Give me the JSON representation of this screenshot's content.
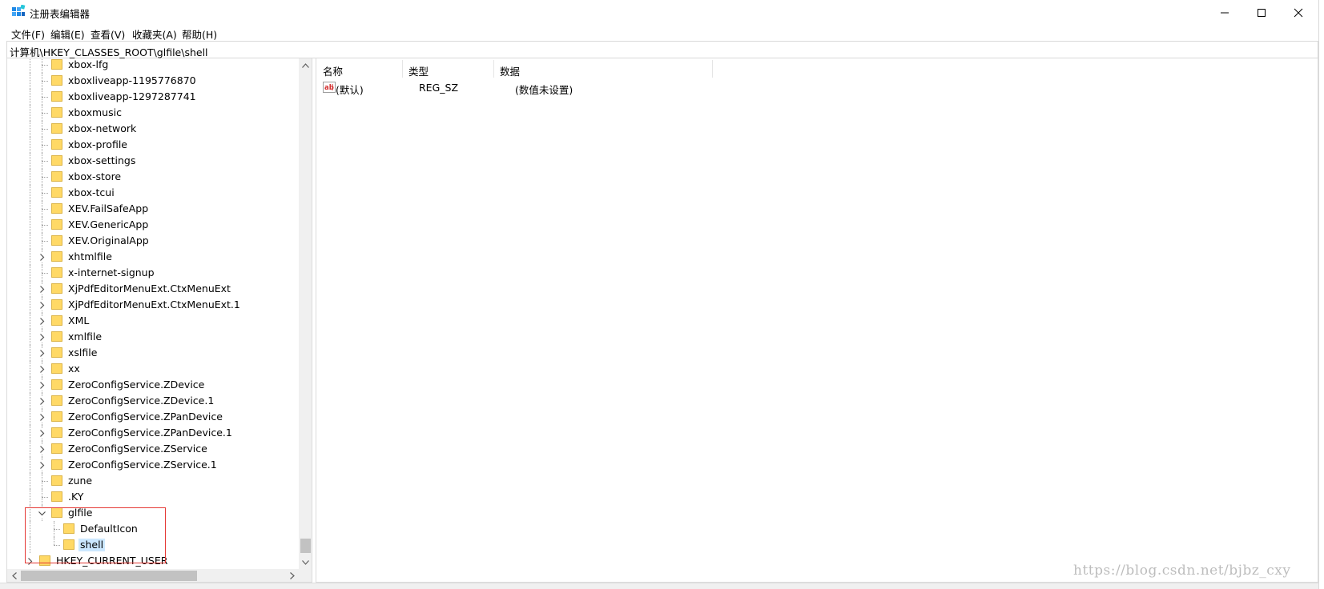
{
  "window": {
    "title": "注册表编辑器"
  },
  "menu": [
    {
      "label": "文件(F)",
      "name": "menu-file"
    },
    {
      "label": "编辑(E)",
      "name": "menu-edit"
    },
    {
      "label": "查看(V)",
      "name": "menu-view"
    },
    {
      "label": "收藏夹(A)",
      "name": "menu-favorites"
    },
    {
      "label": "帮助(H)",
      "name": "menu-help"
    }
  ],
  "address": "计算机\\HKEY_CLASSES_ROOT\\glfile\\shell",
  "tree": [
    {
      "label": "xbox-lfg",
      "level": 1,
      "expander": "none",
      "expanded": false,
      "selected": false
    },
    {
      "label": "xboxliveapp-1195776870",
      "level": 1,
      "expander": "none",
      "expanded": false,
      "selected": false
    },
    {
      "label": "xboxliveapp-1297287741",
      "level": 1,
      "expander": "none",
      "expanded": false,
      "selected": false
    },
    {
      "label": "xboxmusic",
      "level": 1,
      "expander": "none",
      "expanded": false,
      "selected": false
    },
    {
      "label": "xbox-network",
      "level": 1,
      "expander": "none",
      "expanded": false,
      "selected": false
    },
    {
      "label": "xbox-profile",
      "level": 1,
      "expander": "none",
      "expanded": false,
      "selected": false
    },
    {
      "label": "xbox-settings",
      "level": 1,
      "expander": "none",
      "expanded": false,
      "selected": false
    },
    {
      "label": "xbox-store",
      "level": 1,
      "expander": "none",
      "expanded": false,
      "selected": false
    },
    {
      "label": "xbox-tcui",
      "level": 1,
      "expander": "none",
      "expanded": false,
      "selected": false
    },
    {
      "label": "XEV.FailSafeApp",
      "level": 1,
      "expander": "none",
      "expanded": false,
      "selected": false
    },
    {
      "label": "XEV.GenericApp",
      "level": 1,
      "expander": "none",
      "expanded": false,
      "selected": false
    },
    {
      "label": "XEV.OriginalApp",
      "level": 1,
      "expander": "none",
      "expanded": false,
      "selected": false
    },
    {
      "label": "xhtmlfile",
      "level": 1,
      "expander": "collapsed",
      "expanded": false,
      "selected": false
    },
    {
      "label": "x-internet-signup",
      "level": 1,
      "expander": "none",
      "expanded": false,
      "selected": false
    },
    {
      "label": "XjPdfEditorMenuExt.CtxMenuExt",
      "level": 1,
      "expander": "collapsed",
      "expanded": false,
      "selected": false
    },
    {
      "label": "XjPdfEditorMenuExt.CtxMenuExt.1",
      "level": 1,
      "expander": "collapsed",
      "expanded": false,
      "selected": false
    },
    {
      "label": "XML",
      "level": 1,
      "expander": "collapsed",
      "expanded": false,
      "selected": false
    },
    {
      "label": "xmlfile",
      "level": 1,
      "expander": "collapsed",
      "expanded": false,
      "selected": false
    },
    {
      "label": "xslfile",
      "level": 1,
      "expander": "collapsed",
      "expanded": false,
      "selected": false
    },
    {
      "label": "xx",
      "level": 1,
      "expander": "collapsed",
      "expanded": false,
      "selected": false
    },
    {
      "label": "ZeroConfigService.ZDevice",
      "level": 1,
      "expander": "collapsed",
      "expanded": false,
      "selected": false
    },
    {
      "label": "ZeroConfigService.ZDevice.1",
      "level": 1,
      "expander": "collapsed",
      "expanded": false,
      "selected": false
    },
    {
      "label": "ZeroConfigService.ZPanDevice",
      "level": 1,
      "expander": "collapsed",
      "expanded": false,
      "selected": false
    },
    {
      "label": "ZeroConfigService.ZPanDevice.1",
      "level": 1,
      "expander": "collapsed",
      "expanded": false,
      "selected": false
    },
    {
      "label": "ZeroConfigService.ZService",
      "level": 1,
      "expander": "collapsed",
      "expanded": false,
      "selected": false
    },
    {
      "label": "ZeroConfigService.ZService.1",
      "level": 1,
      "expander": "collapsed",
      "expanded": false,
      "selected": false
    },
    {
      "label": "zune",
      "level": 1,
      "expander": "none",
      "expanded": false,
      "selected": false
    },
    {
      "label": ".KY",
      "level": 1,
      "expander": "none",
      "expanded": false,
      "selected": false
    },
    {
      "label": "glfile",
      "level": 1,
      "expander": "expanded",
      "expanded": true,
      "selected": false
    },
    {
      "label": "DefaultIcon",
      "level": 2,
      "expander": "none",
      "expanded": false,
      "selected": false
    },
    {
      "label": "shell",
      "level": 2,
      "expander": "none",
      "expanded": false,
      "selected": true
    },
    {
      "label": "HKEY_CURRENT_USER",
      "level": 0,
      "expander": "collapsed",
      "expanded": false,
      "selected": false
    }
  ],
  "list": {
    "columns": [
      "名称",
      "类型",
      "数据"
    ],
    "rows": [
      {
        "name": "(默认)",
        "type": "REG_SZ",
        "data": "(数值未设置)",
        "icon": "string-value-icon"
      }
    ]
  },
  "watermark": "https://blog.csdn.net/bjbz_cxy",
  "colors": {
    "selection": "#cce8ff",
    "annotation_box": "#e53935",
    "folder": "#ffd966"
  }
}
